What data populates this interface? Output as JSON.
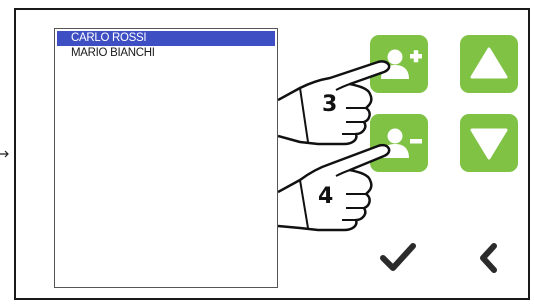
{
  "contacts": {
    "items": [
      {
        "name": "CARLO ROSSI",
        "selected": true
      },
      {
        "name": "MARIO BIANCHI",
        "selected": false
      }
    ]
  },
  "controls": {
    "add_contact_icon": "person-add-icon",
    "remove_contact_icon": "person-remove-icon",
    "up_icon": "triangle-up-icon",
    "down_icon": "triangle-down-icon",
    "confirm_icon": "checkmark-icon",
    "back_icon": "chevron-left-icon"
  },
  "callouts": {
    "step_add": "3",
    "step_remove": "4"
  },
  "colors": {
    "button_green": "#7fc244",
    "selection_blue": "#3e4fc4",
    "glyph_dark": "#2b2b2b"
  }
}
